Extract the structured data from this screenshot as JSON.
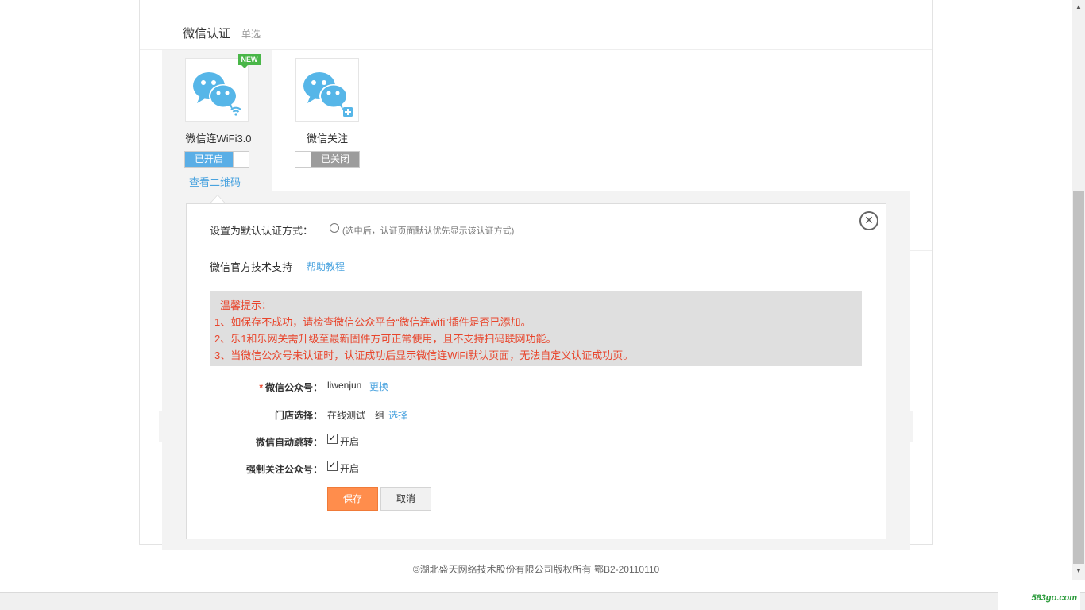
{
  "section": {
    "title": "微信认证",
    "subtitle": "单选"
  },
  "cards": [
    {
      "name": "微信连WiFi3.0",
      "badge": "NEW",
      "toggle_label": "已开启",
      "state": "on",
      "qr_link": "查看二维码"
    },
    {
      "name": "微信关注",
      "toggle_label": "已关闭",
      "state": "off"
    }
  ],
  "panel": {
    "default_label": "设置为默认认证方式：",
    "default_hint": "(选中后，认证页面默认优先显示该认证方式)",
    "close_icon": "✕",
    "support_label": "微信官方技术支持",
    "help_link": "帮助教程",
    "tips": {
      "title": "温馨提示：",
      "lines": [
        "1、如保存不成功，请检查微信公众平台“微信连wifi”插件是否已添加。",
        "2、乐1和乐网关需升级至最新固件方可正常使用，且不支持扫码联网功能。",
        "3、当微信公众号未认证时，认证成功后显示微信连WiFi默认页面，无法自定义认证成功页。"
      ]
    },
    "form": {
      "account_required": "*",
      "account_label": "微信公众号：",
      "account_value": "liwenjun",
      "account_link": "更换",
      "store_label": "门店选择：",
      "store_value": "在线测试一组",
      "store_link": "选择",
      "auto_jump_label": "微信自动跳转：",
      "auto_jump_value": "开启",
      "force_follow_label": "强制关注公众号：",
      "force_follow_value": "开启",
      "checkmark": "✓"
    },
    "buttons": {
      "save": "保存",
      "cancel": "取消"
    }
  },
  "footer": "©湖北盛天网络技术股份有限公司版权所有 鄂B2-20110110",
  "watermark": "583go.com",
  "scrollbar": {
    "up": "▲",
    "down": "▼"
  },
  "colors": {
    "accent": "#4aa3df",
    "toggle_on": "#5aaee6",
    "toggle_off": "#9c9c9c",
    "warning": "#e8452c",
    "save": "#ff8d4c",
    "badge": "#49b648",
    "wechat_blue": "#56b6e8"
  }
}
